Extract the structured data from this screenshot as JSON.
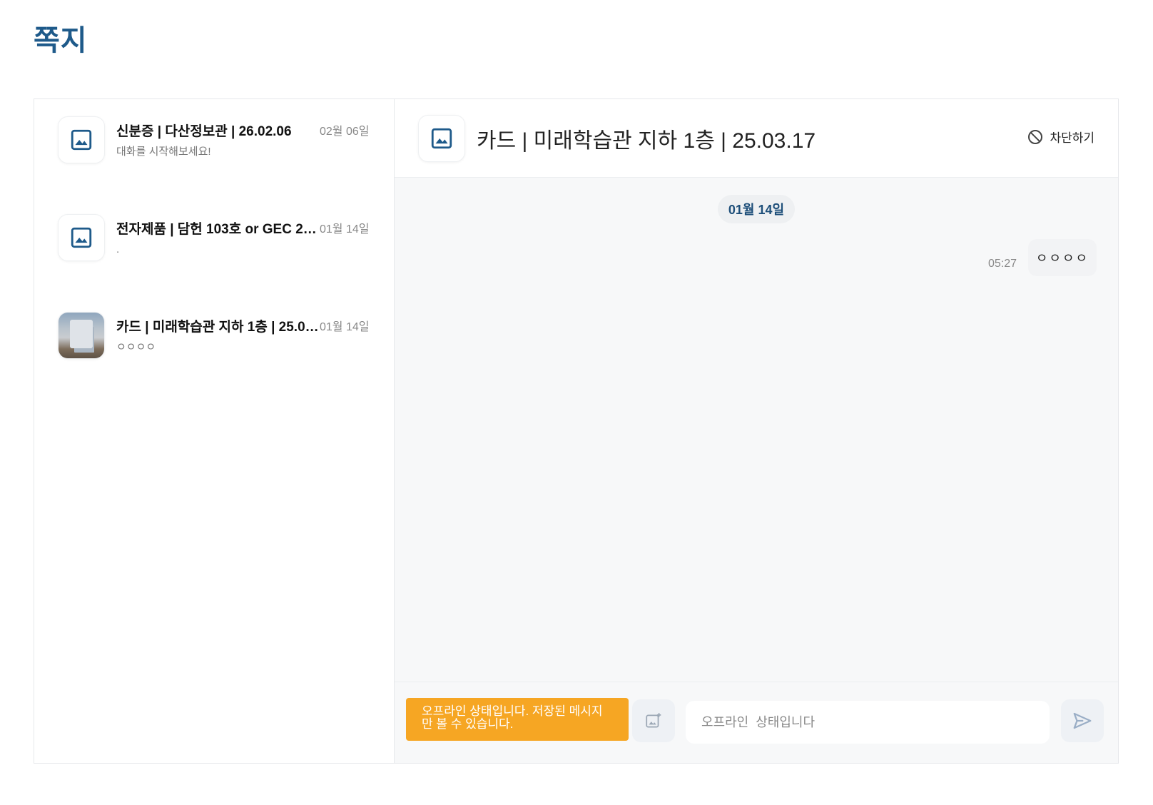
{
  "page": {
    "title": "쪽지"
  },
  "conversations": [
    {
      "title": "신분증 | 다산정보관 | 26.02.06",
      "preview": "대화를 시작해보세요!",
      "date": "02월 06일",
      "thumb": "image-placeholder-icon"
    },
    {
      "title": "전자제품 | 담헌 103호 or GEC 20...",
      "preview": ".",
      "date": "01월 14일",
      "thumb": "image-placeholder-icon"
    },
    {
      "title": "카드 | 미래학습관 지하 1층 | 25.03.17",
      "preview": "ㅇㅇㅇㅇ",
      "date": "01월 14일",
      "thumb": "photo"
    }
  ],
  "chat": {
    "title": "카드 | 미래학습관 지하 1층 | 25.03.17",
    "block_label": "차단하기",
    "date_chip": "01월 14일",
    "messages": [
      {
        "time": "05:27",
        "text": "ㅇㅇㅇㅇ"
      }
    ],
    "offline_banner": "오프라인 상태입니다. 저장된 메시지만 볼 수 있습니다.",
    "input_placeholder": "오프라인  상태입니다"
  },
  "colors": {
    "brand": "#1e5a8a",
    "offline_banner": "#f6a623",
    "chat_bg": "#f7f8f9"
  }
}
